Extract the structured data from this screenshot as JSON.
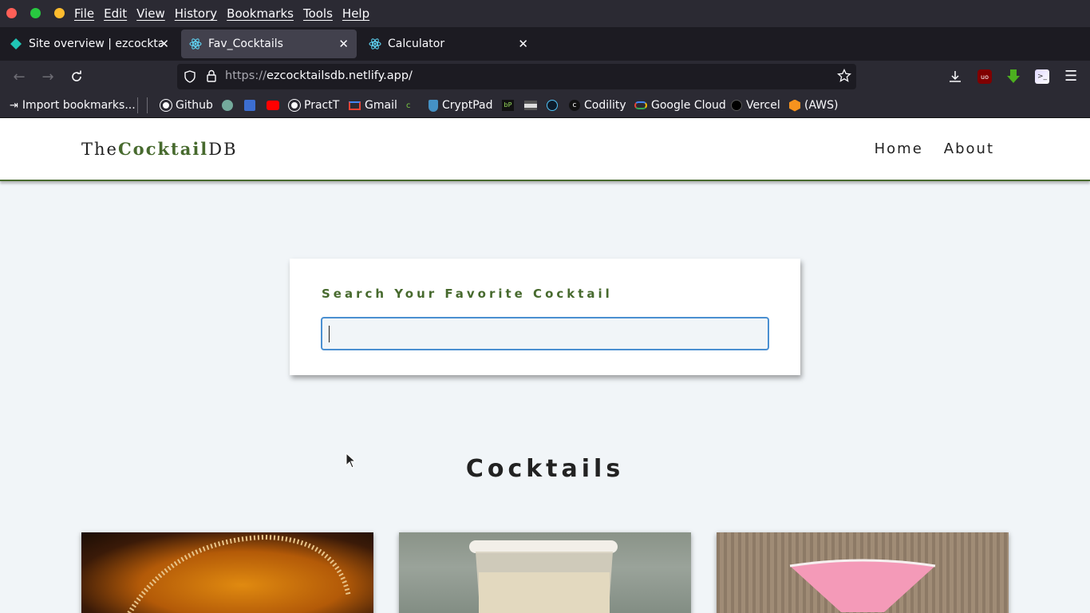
{
  "menubar": {
    "items": [
      "File",
      "Edit",
      "View",
      "History",
      "Bookmarks",
      "Tools",
      "Help"
    ]
  },
  "tabs": [
    {
      "label": "Site overview | ezcocktails",
      "icon": "netlify-icon",
      "active": false
    },
    {
      "label": "Fav_Cocktails",
      "icon": "react-icon",
      "active": true
    },
    {
      "label": "Calculator",
      "icon": "react-icon",
      "active": false
    }
  ],
  "url": {
    "scheme": "https://",
    "host": "ezcocktailsdb.netlify.app/"
  },
  "bookmarks": [
    {
      "label": "Import bookmarks...",
      "icon": "import-icon"
    },
    {
      "label": "Github",
      "icon": "github-icon"
    },
    {
      "label": "",
      "icon": "chatgpt-icon"
    },
    {
      "label": "",
      "icon": "bookmark-blue-icon"
    },
    {
      "label": "",
      "icon": "youtube-icon"
    },
    {
      "label": "PractT",
      "icon": "github-icon"
    },
    {
      "label": "Gmail",
      "icon": "gmail-icon"
    },
    {
      "label": "",
      "icon": "bookmark-green-icon"
    },
    {
      "label": "CryptPad",
      "icon": "cryptpad-icon"
    },
    {
      "label": "",
      "icon": "bookmark-bp-icon"
    },
    {
      "label": "",
      "icon": "bookmark-dark-icon"
    },
    {
      "label": "",
      "icon": "bookmark-round-icon"
    },
    {
      "label": "Codility",
      "icon": "codility-icon"
    },
    {
      "label": "Google Cloud",
      "icon": "google-cloud-icon"
    },
    {
      "label": "Vercel",
      "icon": "vercel-icon"
    },
    {
      "label": "(AWS)",
      "icon": "aws-icon"
    }
  ],
  "site": {
    "logo_prefix": "The",
    "logo_bold": "Cocktail",
    "logo_suffix": "DB",
    "nav": [
      "Home",
      "About"
    ],
    "search_label": "Search Your Favorite Cocktail",
    "search_value": "",
    "section_title": "Cocktails"
  },
  "colors": {
    "accent": "#476a2e",
    "page_bg": "#f1f5f8",
    "focus_border": "#4a8fd1"
  }
}
